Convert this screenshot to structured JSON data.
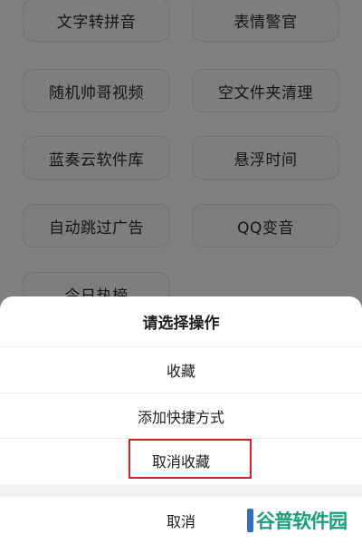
{
  "tools": {
    "row1": [
      "文字转拼音",
      "表情警官"
    ],
    "row2": [
      "随机帅哥视频",
      "空文件夹清理"
    ],
    "row3": [
      "蓝奏云软件库",
      "悬浮时间"
    ],
    "row4": [
      "自动跳过广告",
      "QQ变音"
    ],
    "row5": [
      "今日热榜"
    ]
  },
  "sheet": {
    "title": "请选择操作",
    "options": [
      "收藏",
      "添加快捷方式",
      "取消收藏"
    ],
    "cancel": "取消"
  },
  "watermark": {
    "text": "谷普软件园"
  },
  "colors": {
    "highlight": "#d32020",
    "watermark": "#1aa07a"
  }
}
